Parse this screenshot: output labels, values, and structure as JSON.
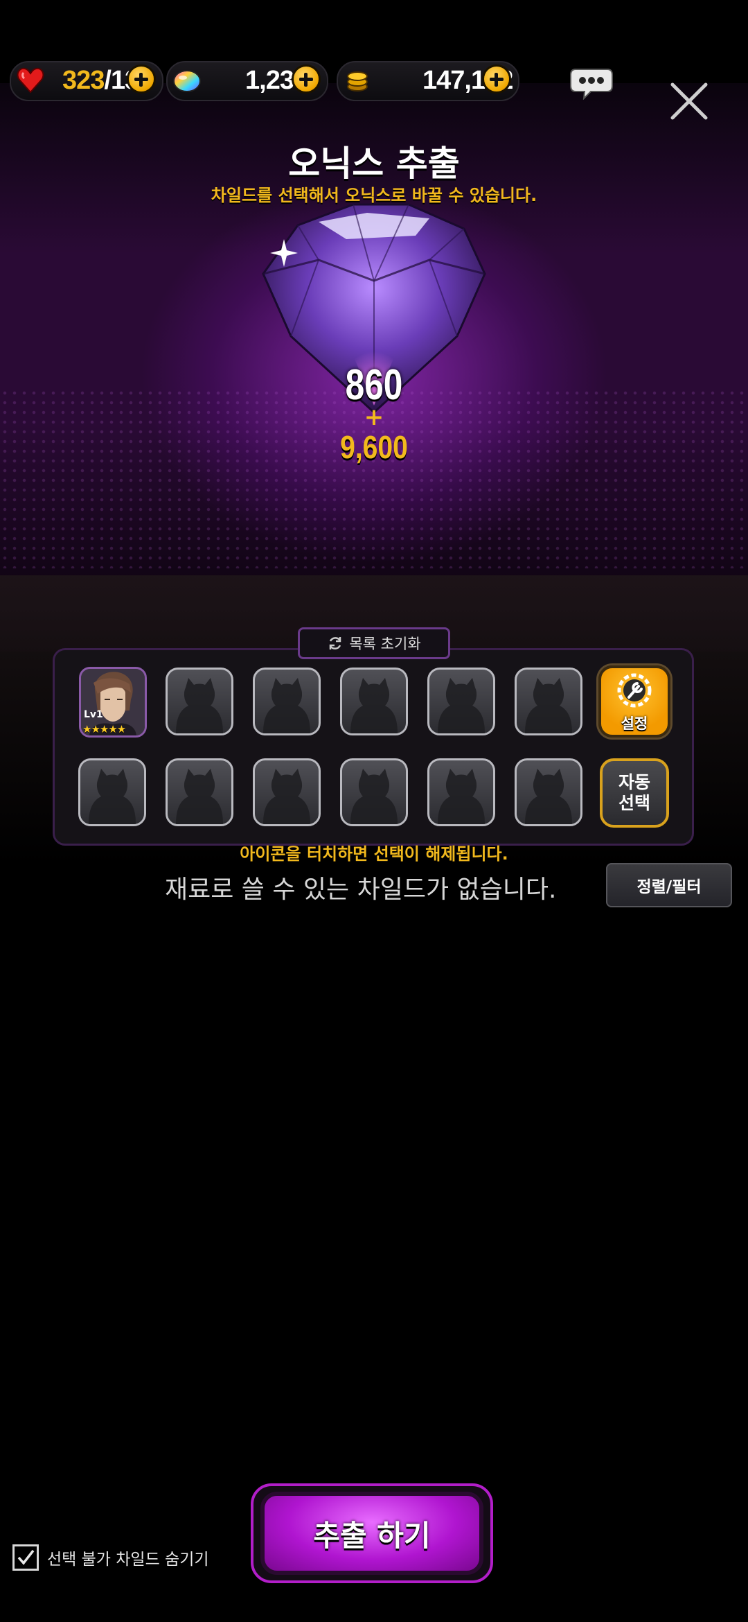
{
  "resources": {
    "stamina": {
      "current": "323",
      "separator": "/",
      "max": "13",
      "icon": "heart-icon"
    },
    "gems": {
      "value": "1,230",
      "icon": "rainbow-gem-icon"
    },
    "gold": {
      "value": "147,192",
      "icon": "gold-coin-icon"
    }
  },
  "header": {
    "title": "오닉스 추출",
    "subtitle": "차일드를 선택해서 오닉스로 바꿀 수 있습니다."
  },
  "onyx": {
    "base": "860",
    "plus": "+",
    "bonus": "9,600"
  },
  "selection": {
    "reset_label": "목록 초기화",
    "selected_child": {
      "level": "Lv1",
      "stars": 5
    },
    "settings_label": "설정",
    "auto_select_line1": "자동",
    "auto_select_line2": "선택",
    "hint": "아이콘을 터치하면 선택이 해제됩니다.",
    "empty_message": "재료로 쓸 수 있는 차일드가 없습니다.",
    "sort_filter_label": "정렬/필터"
  },
  "footer": {
    "extract_label": "추출 하기",
    "hide_unselectable_label": "선택 불가 차일드 숨기기",
    "hide_unselectable_checked": true
  },
  "colors": {
    "accent_gold": "#f2b91d",
    "accent_purple": "#b015d0",
    "background": "#000000"
  }
}
